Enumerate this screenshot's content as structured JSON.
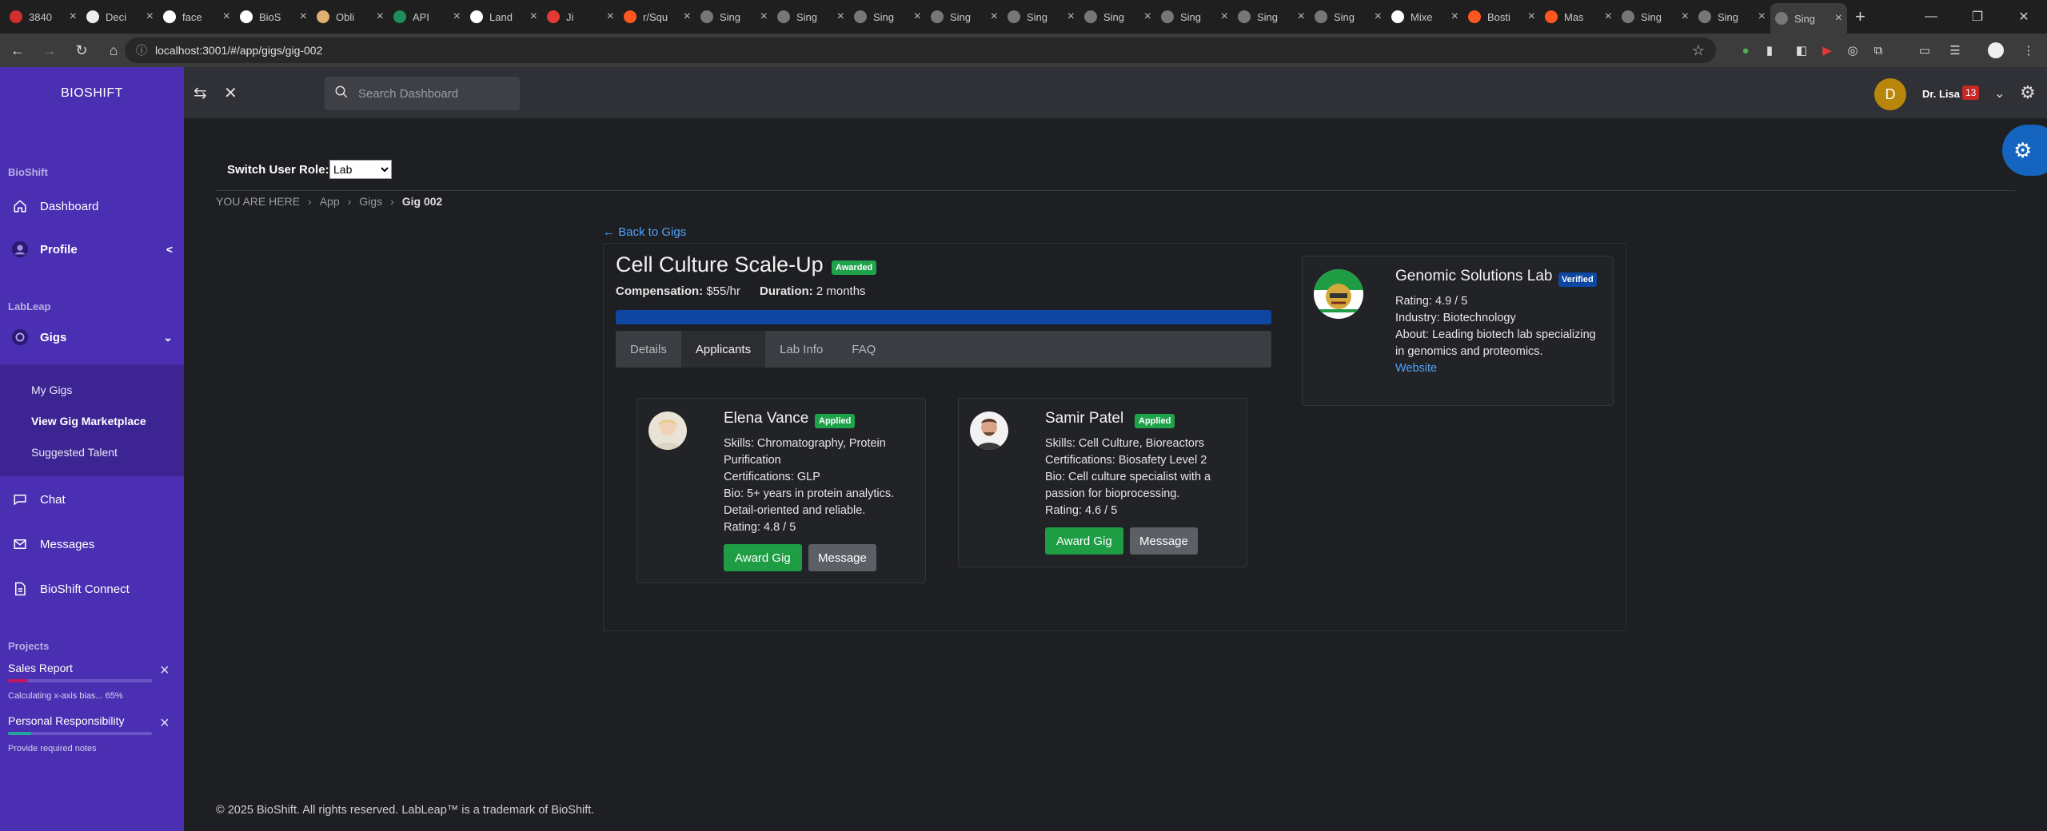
{
  "browser": {
    "tabs": [
      {
        "label": "3840",
        "icon": "flag-icon",
        "color": "#d32f2f"
      },
      {
        "label": "Deci",
        "icon": "circle-icon",
        "color": "#eeeeee"
      },
      {
        "label": "face",
        "icon": "github-icon",
        "color": "#ffffff"
      },
      {
        "label": "BioS",
        "icon": "asterisk-icon",
        "color": "#ffffff"
      },
      {
        "label": "Obli",
        "icon": "circle-icon",
        "color": "#e0b070"
      },
      {
        "label": "API",
        "icon": "dollar-icon",
        "color": "#1e8f5a"
      },
      {
        "label": "Land",
        "icon": "page-icon",
        "color": "#ffffff"
      },
      {
        "label": "Ji",
        "icon": "youtube-icon",
        "color": "#e53935"
      },
      {
        "label": "r/Squ",
        "icon": "reddit-icon",
        "color": "#ff5722"
      },
      {
        "label": "Sing",
        "icon": "tab-icon",
        "color": "#777777"
      },
      {
        "label": "Sing",
        "icon": "tab-icon",
        "color": "#777777"
      },
      {
        "label": "Sing",
        "icon": "tab-icon",
        "color": "#777777"
      },
      {
        "label": "Sing",
        "icon": "tab-icon",
        "color": "#777777"
      },
      {
        "label": "Sing",
        "icon": "tab-icon",
        "color": "#777777"
      },
      {
        "label": "Sing",
        "icon": "tab-icon",
        "color": "#777777"
      },
      {
        "label": "Sing",
        "icon": "tab-icon",
        "color": "#777777"
      },
      {
        "label": "Sing",
        "icon": "tab-icon",
        "color": "#777777"
      },
      {
        "label": "Sing",
        "icon": "tab-icon",
        "color": "#777777"
      },
      {
        "label": "Mixe",
        "icon": "github-icon",
        "color": "#ffffff"
      },
      {
        "label": "Bosti",
        "icon": "reddit-icon",
        "color": "#ff5722"
      },
      {
        "label": "Mas",
        "icon": "reddit-icon",
        "color": "#ff5722"
      },
      {
        "label": "Sing",
        "icon": "tab-icon",
        "color": "#777777"
      },
      {
        "label": "Sing",
        "icon": "tab-icon",
        "color": "#777777"
      },
      {
        "label": "Sing",
        "icon": "tab-icon",
        "color": "#777777",
        "active": true
      }
    ],
    "url": "localhost:3001/#/app/gigs/gig-002"
  },
  "sidebar": {
    "brand": "BIOSHIFT",
    "section_bioshift": "BioShift",
    "dashboard": "Dashboard",
    "profile": "Profile",
    "section_lableap": "LabLeap",
    "gigs": "Gigs",
    "sub": {
      "my_gigs": "My Gigs",
      "view_marketplace": "View Gig Marketplace",
      "suggested_talent": "Suggested Talent"
    },
    "chat": "Chat",
    "messages": "Messages",
    "connect": "BioShift Connect",
    "section_projects": "Projects",
    "projects": [
      {
        "title": "Sales Report",
        "note": "Calculating x-axis bias... 65%",
        "progress": 0.14,
        "color": "#c2185b"
      },
      {
        "title": "Personal Responsibility",
        "note": "Provide required notes",
        "progress": 0.16,
        "color": "#26a69a"
      }
    ]
  },
  "header": {
    "search_placeholder": "Search Dashboard",
    "avatar_initial": "D",
    "user_name": "Dr. Lisa",
    "badge_count": "13"
  },
  "main": {
    "role_label": "Switch User Role:",
    "role_value": "Lab",
    "breadcrumb": {
      "prefix": "YOU ARE HERE",
      "items": [
        "App",
        "Gigs"
      ],
      "current": "Gig 002"
    },
    "back_link": "← Back to Gigs",
    "gig": {
      "title": "Cell Culture Scale-Up",
      "status": "Awarded",
      "comp_label": "Compensation:",
      "comp_value": "$55/hr",
      "dur_label": "Duration:",
      "dur_value": "2 months",
      "progress": 1.0
    },
    "tabs": [
      "Details",
      "Applicants",
      "Lab Info",
      "FAQ"
    ],
    "active_tab": "Applicants",
    "applicants": [
      {
        "name": "Elena Vance",
        "status": "Applied",
        "skills": "Skills: Chromatography, Protein Purification",
        "certs": "Certifications: GLP",
        "bio": "Bio: 5+ years in protein analytics. Detail-oriented and reliable.",
        "rating": "Rating: 4.8 / 5",
        "award_label": "Award Gig",
        "message_label": "Message"
      },
      {
        "name": "Samir Patel",
        "status": "Applied",
        "skills": "Skills: Cell Culture, Bioreactors",
        "certs": "Certifications: Biosafety Level 2",
        "bio": "Bio: Cell culture specialist with a passion for bioprocessing.",
        "rating": "Rating: 4.6 / 5",
        "award_label": "Award Gig",
        "message_label": "Message"
      }
    ],
    "lab": {
      "name": "Genomic Solutions Lab",
      "status": "Verified",
      "rating": "Rating: 4.9 / 5",
      "industry": "Industry: Biotechnology",
      "about": "About: Leading biotech lab specializing in genomics and proteomics.",
      "website": "Website"
    },
    "footer": "© 2025 BioShift. All rights reserved. LabLeap™ is a trademark of BioShift."
  },
  "colors": {
    "sidebar": "#4b2fb2",
    "accent_green": "#1f9d45",
    "accent_blue": "#0d47a1",
    "link": "#4da3ff"
  }
}
